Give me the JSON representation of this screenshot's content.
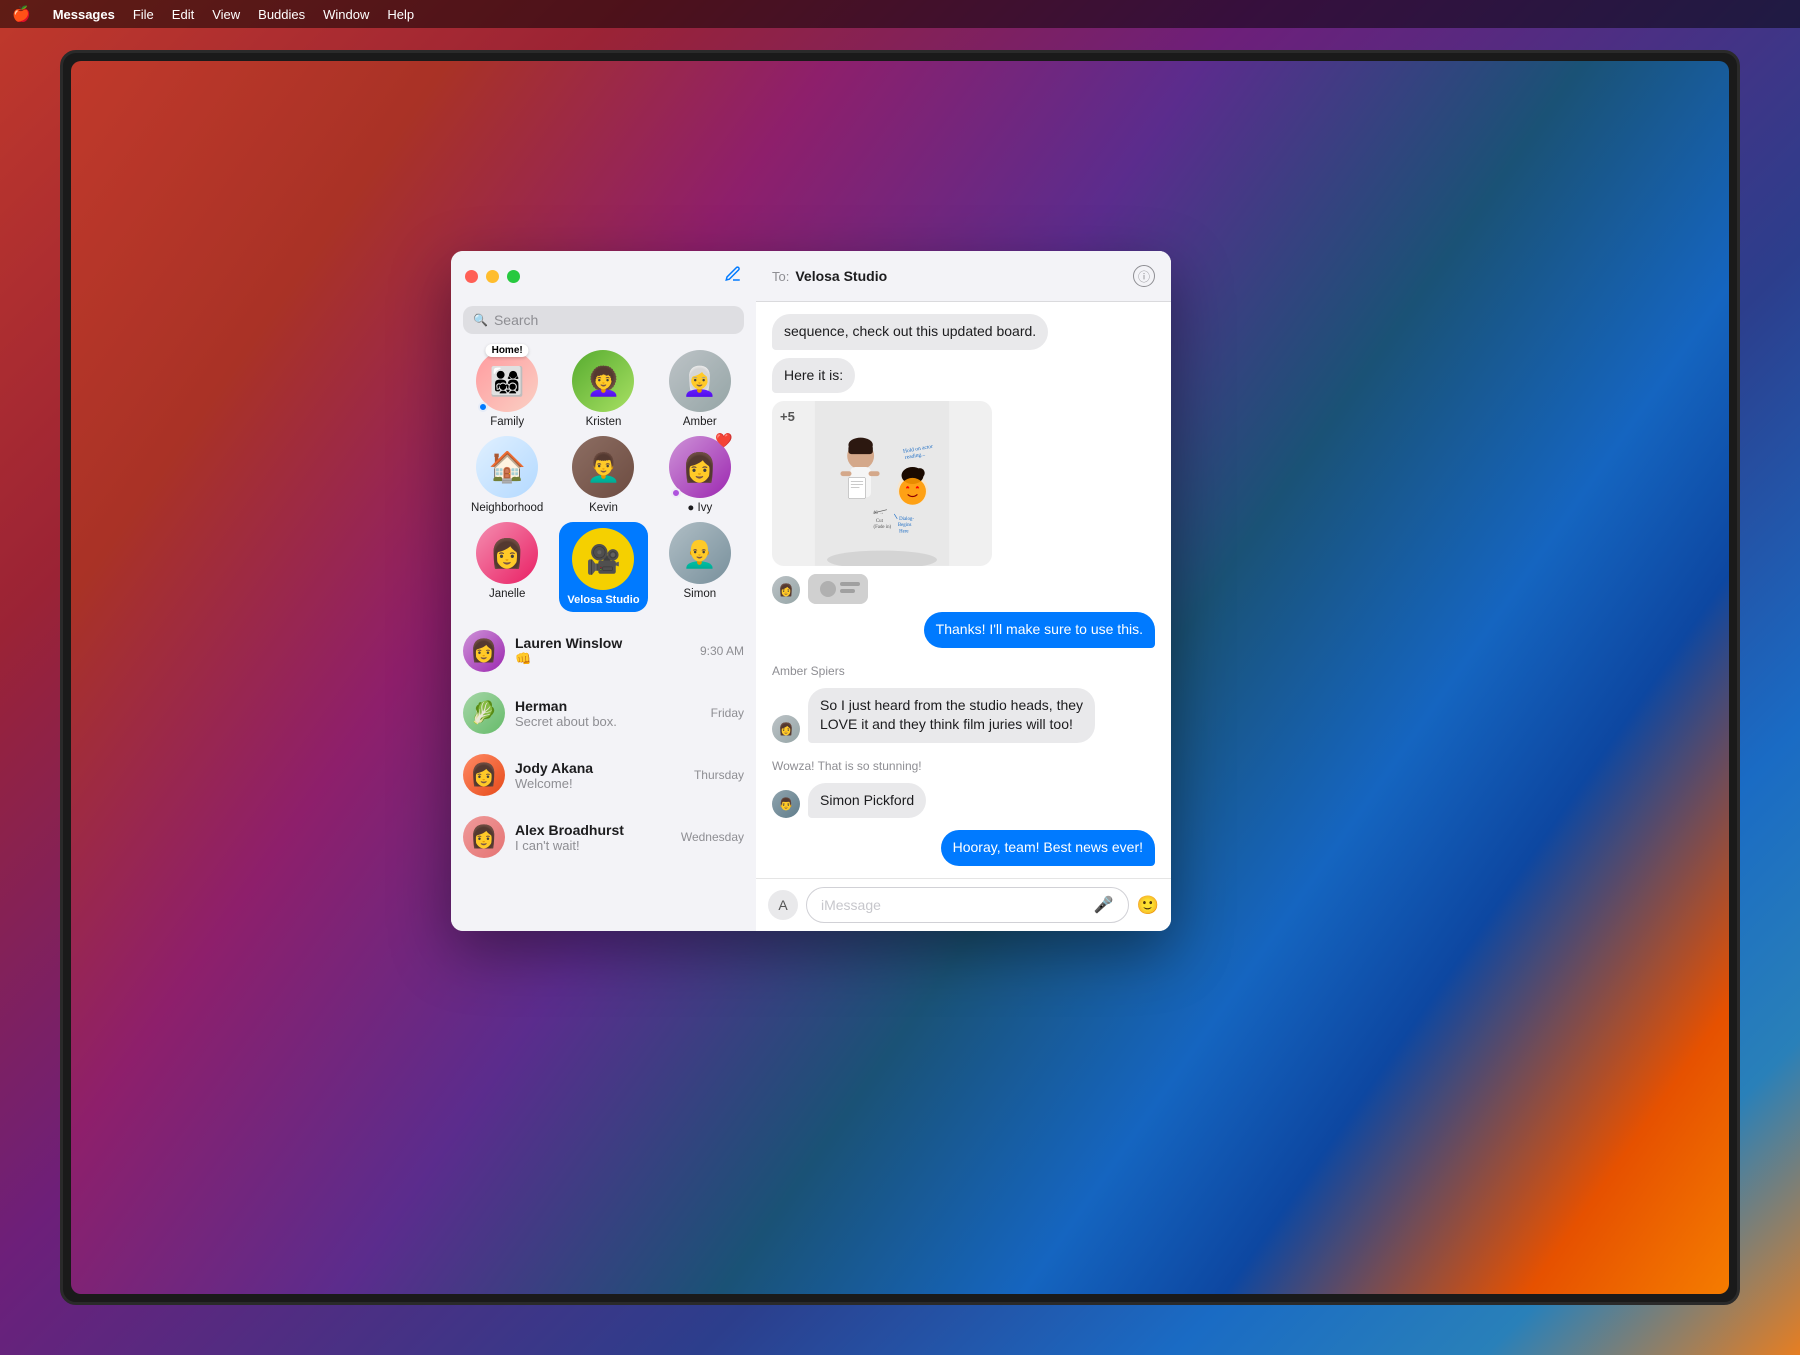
{
  "menubar": {
    "apple": "🍎",
    "items": [
      "Messages",
      "File",
      "Edit",
      "View",
      "Buddies",
      "Window",
      "Help"
    ]
  },
  "window": {
    "title": "Messages",
    "chat_recipient": "Velosa Studio",
    "to_label": "To:",
    "search_placeholder": "Search"
  },
  "pinned": [
    {
      "id": "family",
      "label": "Family",
      "emoji": "👨‍👩‍👧‍👦",
      "badge": "Home!",
      "dot": "blue",
      "avatar_class": "av-family"
    },
    {
      "id": "kristen",
      "label": "Kristen",
      "emoji": "👩",
      "avatar_class": "av-kristen"
    },
    {
      "id": "amber",
      "label": "Amber",
      "emoji": "👩‍🦳",
      "avatar_class": "av-amber"
    },
    {
      "id": "neighborhood",
      "label": "Neighborhood",
      "emoji": "🏠",
      "avatar_class": "av-neighborhood"
    },
    {
      "id": "kevin",
      "label": "Kevin",
      "emoji": "👨‍🦱",
      "avatar_class": "av-kevin"
    },
    {
      "id": "ivy",
      "label": "● Ivy",
      "emoji": "👩",
      "avatar_class": "av-ivy",
      "heart": true,
      "dot": "purple"
    },
    {
      "id": "janelle",
      "label": "Janelle",
      "emoji": "👩",
      "avatar_class": "av-janelle"
    },
    {
      "id": "velosa",
      "label": "Velosa Studio",
      "emoji": "🎥",
      "avatar_class": "av-velosa",
      "selected": true
    },
    {
      "id": "simon",
      "label": "Simon",
      "emoji": "👨",
      "avatar_class": "av-simon"
    }
  ],
  "conversations": [
    {
      "id": "lauren",
      "name": "Lauren Winslow",
      "preview": "👊",
      "time": "9:30 AM",
      "emoji": "👩",
      "avatar_class": "av-lauren"
    },
    {
      "id": "herman",
      "name": "Herman",
      "preview": "Secret about box.",
      "time": "Friday",
      "emoji": "🥬",
      "avatar_class": "av-herman"
    },
    {
      "id": "jody",
      "name": "Jody Akana",
      "preview": "Welcome!",
      "time": "Thursday",
      "emoji": "👩",
      "avatar_class": "av-jody"
    },
    {
      "id": "alex",
      "name": "Alex Broadhurst",
      "preview": "I can't wait!",
      "time": "Wednesday",
      "emoji": "👩",
      "avatar_class": "av-alex"
    }
  ],
  "messages": [
    {
      "type": "incoming",
      "text": "sequence, check out this updated board.",
      "id": "msg1"
    },
    {
      "type": "incoming",
      "text": "Here it is:",
      "id": "msg2"
    },
    {
      "type": "outgoing",
      "text": "Thanks! I'll make sure to use this.",
      "id": "msg3"
    },
    {
      "type": "sender_label",
      "text": "Amber Spiers",
      "id": "sender1"
    },
    {
      "type": "incoming",
      "text": "So I just heard from the studio heads, they LOVE it and they think film juries will too!",
      "id": "msg4",
      "has_avatar": true
    },
    {
      "type": "sender_label",
      "text": "Simon Pickford",
      "id": "sender2"
    },
    {
      "type": "incoming",
      "text": "Wowza! That is so stunning!",
      "id": "msg5",
      "has_avatar": true
    },
    {
      "type": "outgoing",
      "text": "Hooray, team! Best news ever!",
      "id": "msg6"
    }
  ],
  "input": {
    "placeholder": "iMessage"
  },
  "storyboard": {
    "plus_count": "+5"
  }
}
